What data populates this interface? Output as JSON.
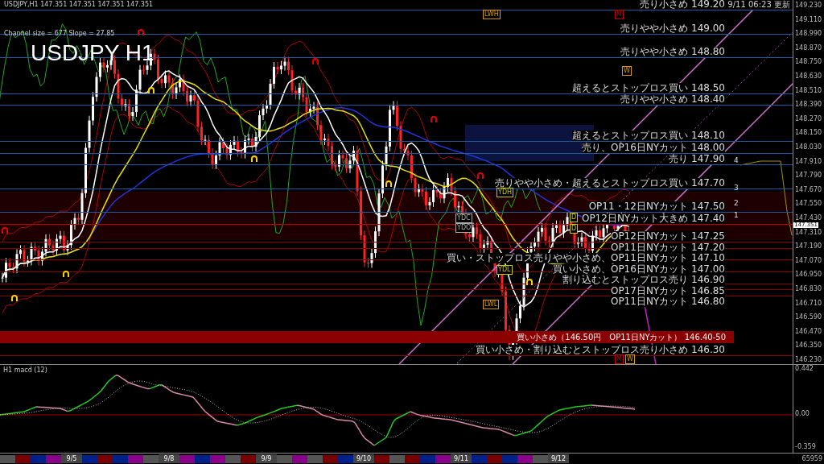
{
  "header": "USDJPY,H1  147.351 147.351 147.351 147.351",
  "channel_info": "Channel size = 677 Slope = 27.85",
  "title": "USDJPY H1",
  "updated": "9/11 06:23 更新",
  "levels": [
    {
      "kind": "line",
      "label": "売り小さめ 149.20",
      "color": "#1e5aa0"
    },
    {
      "kind": "line",
      "label": "売りやや小さめ 149.00",
      "color": "#1e5aa0"
    },
    {
      "kind": "line",
      "label": "売りやや小さめ 148.80",
      "color": "#1e5aa0"
    },
    {
      "kind": "line",
      "label": "超えるとストップロス買い 148.50",
      "color": "#1e5aa0"
    },
    {
      "kind": "line",
      "label": "売りやや小さめ 148.40",
      "color": "#1e5aa0"
    },
    {
      "kind": "line",
      "label": "超えるとストップロス買い 148.10",
      "color": "#1e5aa0"
    },
    {
      "kind": "line",
      "label": "売り、OP16日NYカット 148.00",
      "color": "#1e5aa0"
    },
    {
      "kind": "line",
      "label": "売り 147.90",
      "color": "#1e5aa0"
    },
    {
      "kind": "line",
      "label": "売りやや小さめ・超えるとストップロス買い 147.70",
      "color": "#1e5aa0"
    },
    {
      "kind": "line",
      "label": "OP11・12日NYカット 147.50",
      "color": "#1e5aa0"
    },
    {
      "kind": "line",
      "label": "OP12日NYカット大きめ 147.40",
      "color": "#c00000"
    },
    {
      "kind": "line",
      "label": "OP12日NYカット 147.25",
      "color": "#8b0000"
    },
    {
      "kind": "line",
      "label": "OP11日NYカット 147.20",
      "color": "#8b0000"
    },
    {
      "kind": "line",
      "label": "買い・ストップロス売りやや小さめ、OP11日NYカット 147.10",
      "color": "#8b0000"
    },
    {
      "kind": "line",
      "label": "買い小さめ、OP16日NYカット 147.00",
      "color": "#8b0000"
    },
    {
      "kind": "line",
      "label": "割り込むとストップロス売り 146.90",
      "color": "#8b0000"
    },
    {
      "kind": "line",
      "label": "OP17日NYカット 146.85",
      "color": "#8b0000"
    },
    {
      "kind": "line",
      "label": "OP11日NYカット 146.80",
      "color": "#8b0000"
    },
    {
      "kind": "band",
      "label": "買い小さめ（146.50円　OP11日NYカット） 146.40-50",
      "color": "#8b0000"
    },
    {
      "kind": "line",
      "label": "買い小さめ・割り込むとストップロス売り小さめ 146.30",
      "color": "#8b0000"
    }
  ],
  "markers": [
    "LWH",
    "M",
    "W",
    "YDH",
    "YDC",
    "YDO",
    "YDL",
    "LWL",
    "D",
    "D",
    "4",
    "3",
    "2",
    "1",
    "M",
    "W"
  ],
  "price_axis": [
    "149.230",
    "149.110",
    "148.990",
    "148.870",
    "148.750",
    "148.630",
    "148.510",
    "148.390",
    "148.270",
    "148.150",
    "148.030",
    "147.910",
    "147.790",
    "147.670",
    "147.550",
    "147.430",
    "147.310",
    "147.190",
    "147.070",
    "146.950",
    "146.830",
    "146.710",
    "146.590",
    "146.470",
    "146.350",
    "146.230"
  ],
  "current_price": "147.351",
  "macd": {
    "label": "H1 macd (12)",
    "axis": [
      "0.442",
      "0.00",
      "-0.359"
    ]
  },
  "dates": [
    "9/5",
    "9/8",
    "9/9",
    "9/10",
    "9/11",
    "9/12"
  ],
  "corner_value": "65959"
}
